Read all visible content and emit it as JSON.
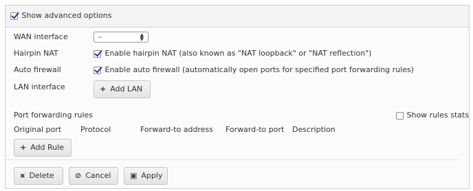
{
  "advanced": {
    "label": "Show advanced options",
    "checked": true
  },
  "wan": {
    "label": "WAN interface",
    "value": "–"
  },
  "hairpin": {
    "label": "Hairpin NAT",
    "option": "Enable hairpin NAT (also known as \"NAT loopback\" or \"NAT reflection\")",
    "checked": true
  },
  "firewall": {
    "label": "Auto firewall",
    "option": "Enable auto firewall (automatically open ports for specified port forwarding rules)",
    "checked": true
  },
  "lan": {
    "label": "LAN interface",
    "button": "Add LAN",
    "button_icon": "+"
  },
  "port_forwarding": {
    "title": "Port forwarding rules",
    "stats_label": "Show rules stats",
    "stats_checked": false,
    "columns": [
      "Original port",
      "Protocol",
      "Forward-to address",
      "Forward-to port",
      "Description"
    ],
    "add_rule": "Add Rule",
    "add_rule_icon": "+"
  },
  "actions": {
    "delete": "Delete",
    "delete_icon": "✖",
    "cancel": "Cancel",
    "cancel_icon": "⊘",
    "apply": "Apply",
    "apply_icon": "▣"
  }
}
